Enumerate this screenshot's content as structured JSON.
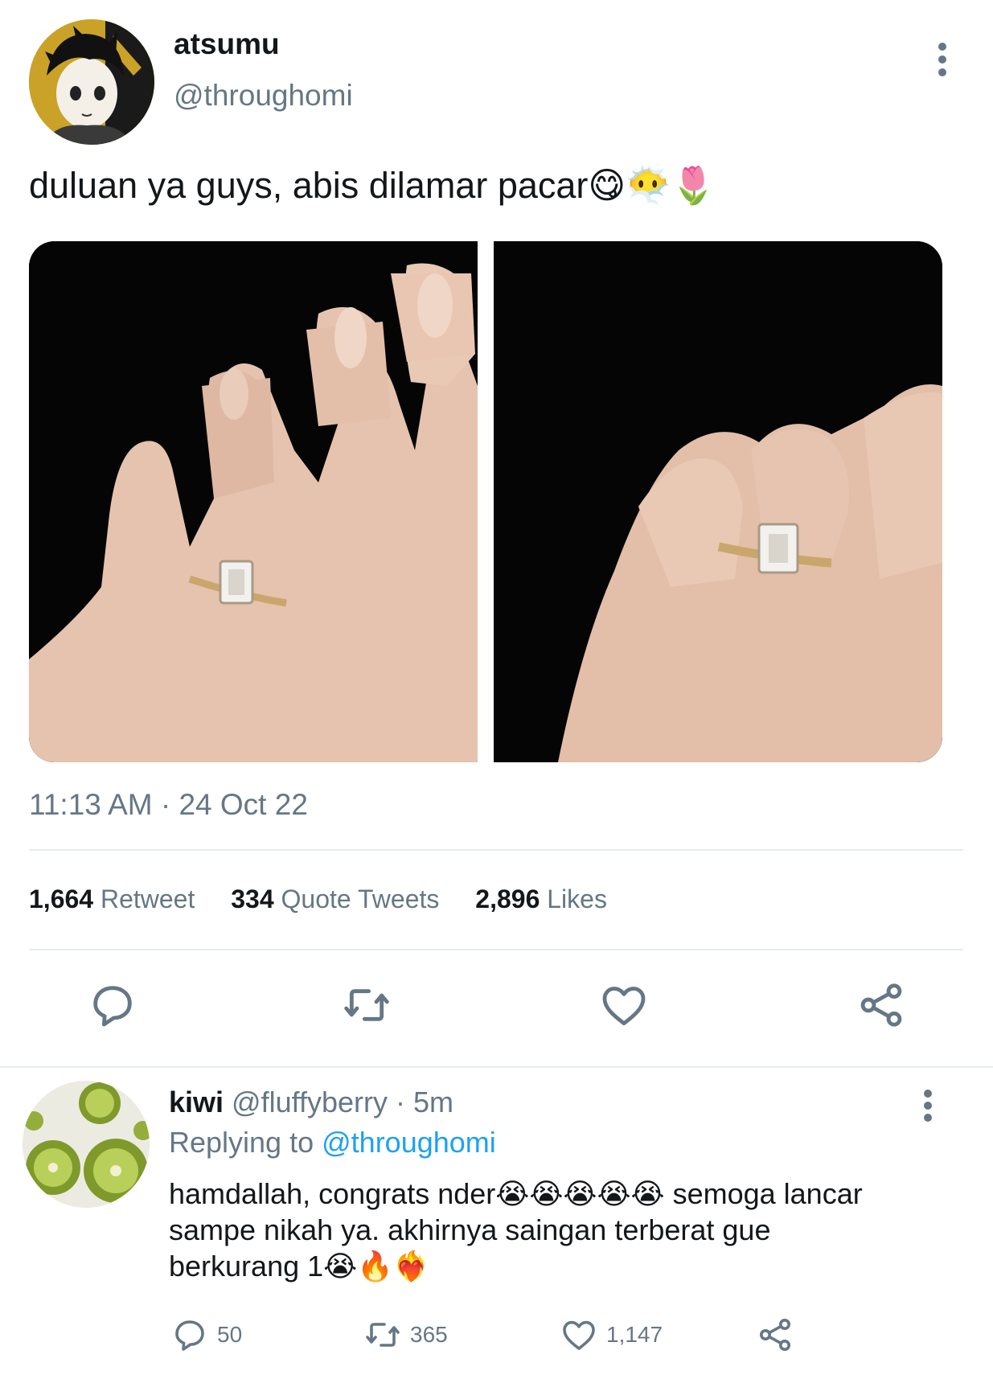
{
  "tweet": {
    "display_name": "atsumu",
    "handle": "@throughomi",
    "text": "duluan ya guys, abis dilamar pacar",
    "text_emoji": "😋😶‍🌫️🌷",
    "timestamp": "11:13 AM · 24 Oct 22",
    "images": [
      {
        "description_icon": "hand-ring-photo"
      },
      {
        "description_icon": "hand-ring-photo"
      }
    ],
    "stats": {
      "retweets_count": "1,664",
      "retweets_label": "Retweet",
      "quotes_count": "334",
      "quotes_label": "Quote Tweets",
      "likes_count": "2,896",
      "likes_label": "Likes"
    }
  },
  "reply": {
    "display_name": "kiwi",
    "handle": "@fluffyberry",
    "time": "· 5m",
    "replying_prefix": "Replying to",
    "replying_to": "@throughomi",
    "text_line1": "hamdallah, congrats nder",
    "emoji_1": "😭😭😭😭😭",
    "text_line1b": " semoga lancar",
    "text_line2": "sampe nikah ya. akhirnya saingan terberat gue",
    "text_line3": "berkurang 1",
    "emoji_2": "😭🔥❤️‍🔥",
    "actions": {
      "replies": "50",
      "retweets": "365",
      "likes": "1,147"
    }
  },
  "colors": {
    "text": "#14171a",
    "muted": "#657786",
    "link": "#1da1f2",
    "divider": "#e6ecf0"
  }
}
